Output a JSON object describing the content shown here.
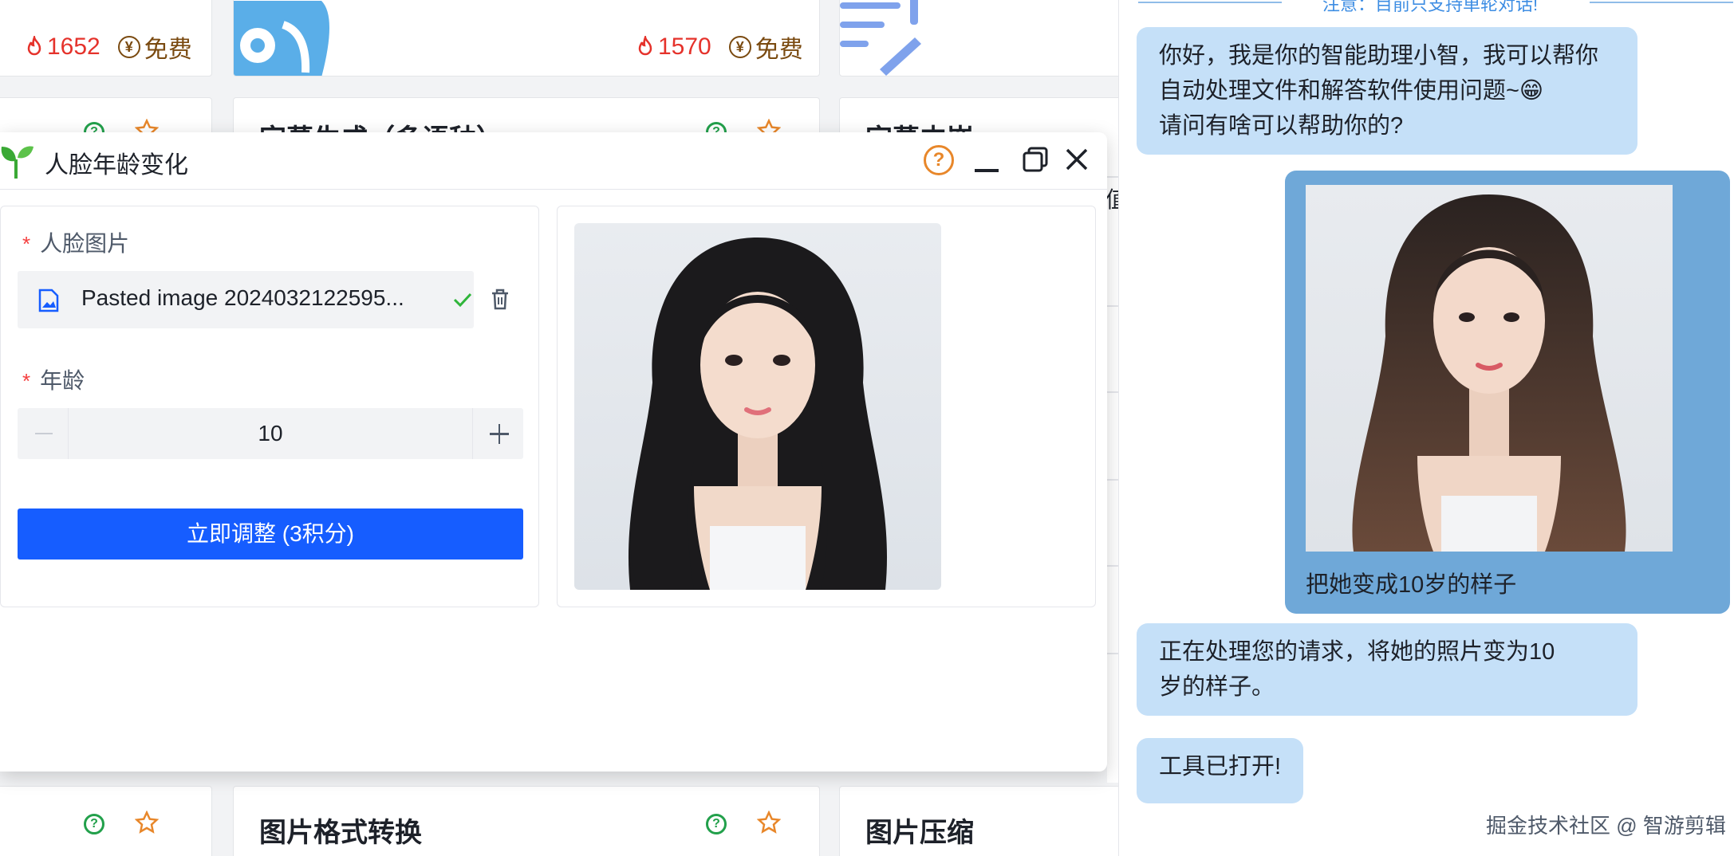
{
  "background_cards": {
    "card1": {
      "hot": "1652",
      "fee": "免费"
    },
    "card2": {
      "hot": "1570",
      "fee": "免费"
    },
    "row2_title_mid": "字幕生成（多语种）",
    "row2_title_right": "字幕内嵌",
    "row3_title_mid": "图片格式转换",
    "row3_title_right": "图片压缩",
    "peek_char": "值"
  },
  "modal": {
    "title": "人脸年龄变化",
    "help": "?",
    "face_label": "人脸图片",
    "file_name": "Pasted image 2024032122595...",
    "age_label": "年龄",
    "age_value": "10",
    "submit_label": "立即调整 (3积分)",
    "required_mark": "*"
  },
  "chat": {
    "notice": "注意：目前只支持单轮对话!",
    "greeting_lines": [
      "你好，我是你的智能助理小智，我可以帮你",
      "自动处理文件和解答软件使用问题~😁",
      "请问有啥可以帮助你的?"
    ],
    "user_caption": "把她变成10岁的样子",
    "processing_lines": [
      "正在处理您的请求，将她的照片变为10",
      "岁的样子。"
    ],
    "tool_opened": "工具已打开!"
  },
  "watermark": "掘金技术社区 @ 智游剪辑",
  "colors": {
    "primary": "#165dff",
    "bubble": "#c5e0f8",
    "user_bubble": "#6fa8d8",
    "hot": "#e5322b"
  },
  "icons": [
    "fire-icon",
    "yen-icon",
    "question-icon",
    "star-icon",
    "sprout-icon",
    "help-icon",
    "minimize-icon",
    "maximize-icon",
    "close-icon",
    "image-file-icon",
    "check-icon",
    "trash-icon",
    "minus-icon",
    "plus-icon"
  ]
}
